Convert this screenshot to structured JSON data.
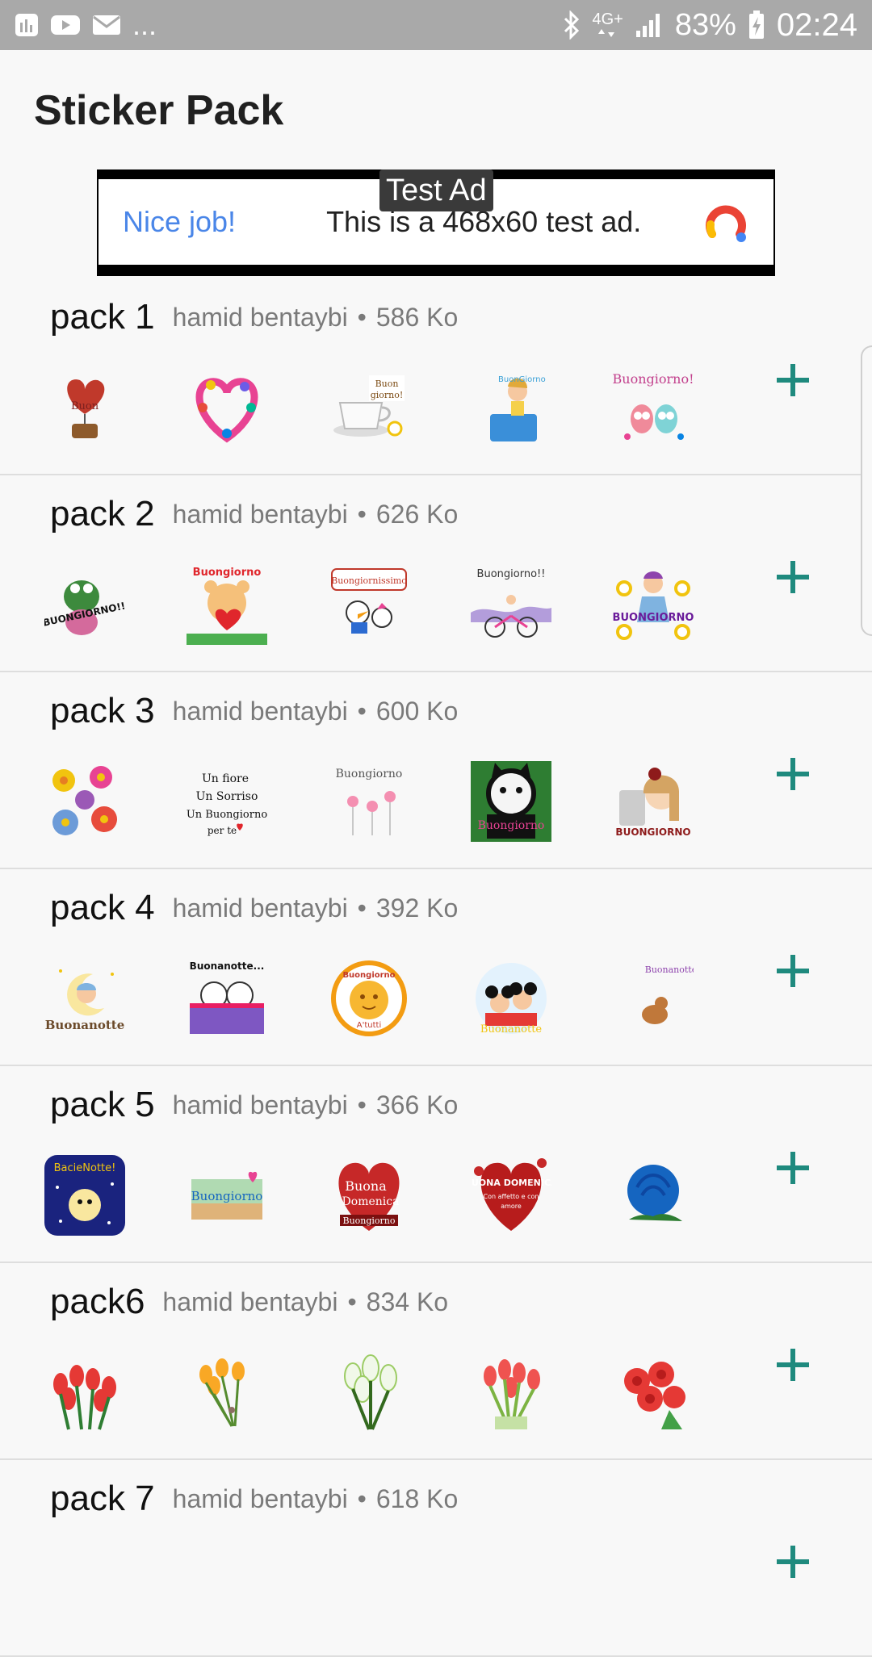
{
  "status_bar": {
    "left_icons": [
      "equalizer-icon",
      "youtube-icon",
      "mail-icon"
    ],
    "overflow": "...",
    "network": "4G+",
    "battery": "83%",
    "time": "02:24"
  },
  "app_bar": {
    "title": "Sticker Pack"
  },
  "ad": {
    "label": "Test Ad",
    "headline": "Nice job!",
    "body": "This is a 468x60 test ad."
  },
  "packs": [
    {
      "name": "pack 1",
      "author": "hamid bentaybi",
      "size": "586 Ko",
      "stickers": [
        "heart-balloon-sticker",
        "flower-wreath-sticker",
        "coffee-cup-sticker",
        "girl-sticker",
        "owls-sticker"
      ]
    },
    {
      "name": "pack 2",
      "author": "hamid bentaybi",
      "size": "626 Ko",
      "stickers": [
        "frog-sticker",
        "teddy-bear-sticker",
        "donald-duck-sticker",
        "bicycle-sticker",
        "flower-girl-sticker"
      ]
    },
    {
      "name": "pack 3",
      "author": "hamid bentaybi",
      "size": "600 Ko",
      "stickers": [
        "flowers-sticker",
        "text-note-sticker",
        "pink-flowers-sticker",
        "cat-sticker",
        "doll-sticker"
      ]
    },
    {
      "name": "pack 4",
      "author": "hamid bentaybi",
      "size": "392 Ko",
      "stickers": [
        "moon-baby-sticker",
        "cats-in-bed-sticker",
        "sun-sticker",
        "mickey-minnie-sticker",
        "crescent-moon-sticker"
      ]
    },
    {
      "name": "pack 5",
      "author": "hamid bentaybi",
      "size": "366 Ko",
      "stickers": [
        "night-stars-sticker",
        "buongiorno-sticker",
        "red-heart-sticker",
        "rose-heart-sticker",
        "blue-rose-sticker"
      ]
    },
    {
      "name": "pack6",
      "author": "hamid bentaybi",
      "size": "834 Ko",
      "stickers": [
        "red-tulips-sticker",
        "yellow-tulips-sticker",
        "white-tulips-sticker",
        "tulips-bouquet-sticker",
        "red-flowers-sticker"
      ]
    },
    {
      "name": "pack 7",
      "author": "hamid bentaybi",
      "size": "618 Ko",
      "stickers": []
    }
  ],
  "colors": {
    "accent": "#1f8a7e",
    "status_bar": "#a9a9a9",
    "ad_link": "#4a86e8"
  }
}
